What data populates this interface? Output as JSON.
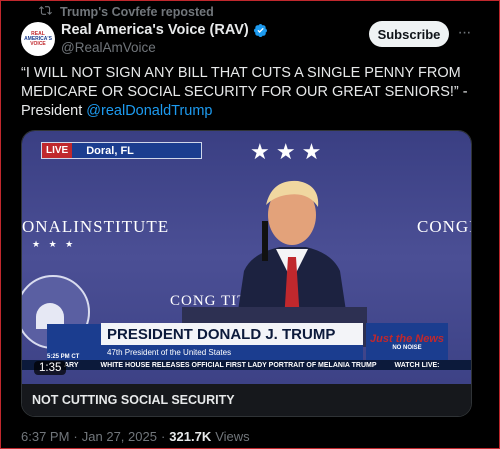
{
  "repost": {
    "label": "Trump's Covfefe reposted"
  },
  "author": {
    "display_name": "Real America's Voice (RAV)",
    "handle": "@RealAmVoice",
    "avatar_text": [
      "REAL",
      "AMERICA'S",
      "VOICE"
    ],
    "verified": true
  },
  "actions": {
    "subscribe_label": "Subscribe",
    "more_label": "···"
  },
  "tweet": {
    "text": "“I WILL NOT SIGN ANY BILL THAT CUTS A SINGLE PENNY FROM MEDICARE OR SOCIAL SECURITY FOR OUR GREAT SENIORS!” - President ",
    "mention": "@realDonaldTrump"
  },
  "video": {
    "live_label": "LIVE",
    "location": "Doral, FL",
    "bg_text_left": "ONALINSTITUTE",
    "bg_text_right": "CONGI",
    "bg_text_center": "CONG            TITUTE",
    "lower_third_title": "PRESIDENT DONALD J. TRUMP",
    "lower_third_subtitle": "47th President of the United States",
    "time_bug": "5:25 PM CT",
    "logo_line1": "Just the News",
    "logo_line2": "NO NOISE",
    "ticker_left": "ARY",
    "ticker_message": "WHITE HOUSE RELEASES OFFICIAL FIRST LADY PORTRAIT OF MELANIA TRUMP",
    "ticker_right": "WATCH LIVE:",
    "duration": "1:35",
    "caption": "NOT CUTTING SOCIAL SECURITY"
  },
  "meta": {
    "time": "6:37 PM",
    "separator": "·",
    "date": "Jan 27, 2025",
    "views_count": "321.7K",
    "views_label": "Views"
  },
  "colors": {
    "link": "#1d9bf0",
    "muted": "#71767b",
    "live_red": "#c0282d",
    "navy": "#1b3d8f"
  }
}
